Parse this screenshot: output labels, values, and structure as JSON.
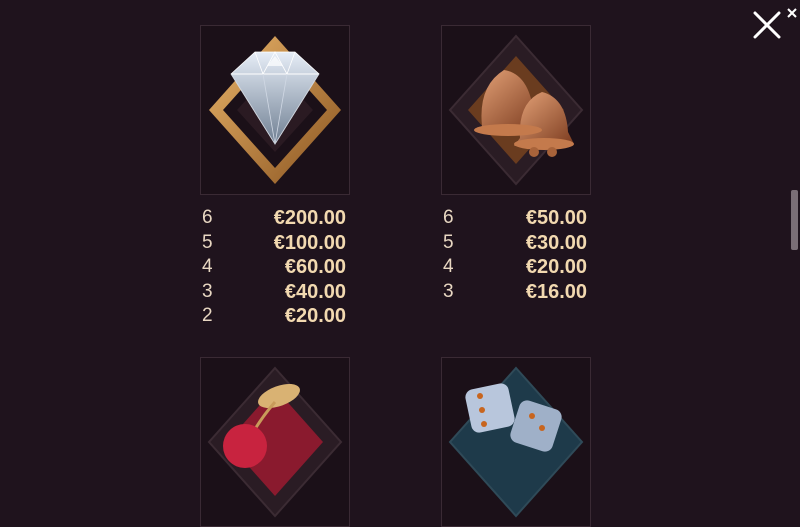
{
  "symbols": [
    {
      "icon": "diamond-icon",
      "pays": [
        {
          "count": "6",
          "amount": "€200.00"
        },
        {
          "count": "5",
          "amount": "€100.00"
        },
        {
          "count": "4",
          "amount": "€60.00"
        },
        {
          "count": "3",
          "amount": "€40.00"
        },
        {
          "count": "2",
          "amount": "€20.00"
        }
      ]
    },
    {
      "icon": "bells-icon",
      "pays": [
        {
          "count": "6",
          "amount": "€50.00"
        },
        {
          "count": "5",
          "amount": "€30.00"
        },
        {
          "count": "4",
          "amount": "€20.00"
        },
        {
          "count": "3",
          "amount": "€16.00"
        }
      ]
    },
    {
      "icon": "cherry-icon"
    },
    {
      "icon": "dice-icon"
    }
  ],
  "controls": {
    "close_icon": "close-icon"
  },
  "colors": {
    "background": "#1f131d",
    "amount_text": "#f2d9b0",
    "count_text": "#e8d7c2",
    "gold_frame": "#c98a3a",
    "bronze": "#b86a3c"
  }
}
